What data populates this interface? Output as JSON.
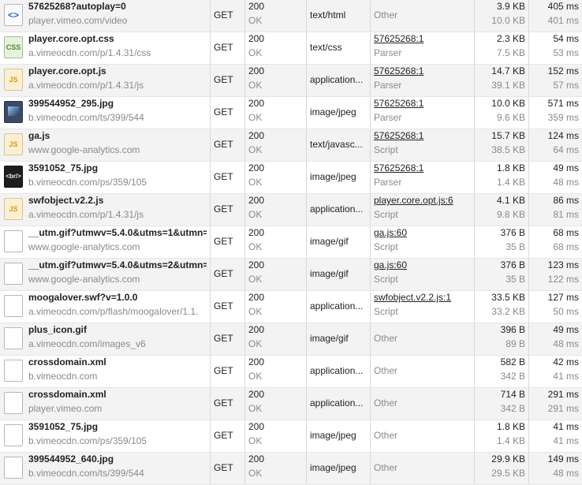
{
  "requests": [
    {
      "name": "57625268?autoplay=0",
      "domain": "player.vimeo.com/video",
      "icon": "html",
      "icon_label": "<>",
      "method": "GET",
      "status": "200",
      "status_text": "OK",
      "type": "text/html",
      "initiator": "Other",
      "initiator_detail": "",
      "size": "3.9 KB",
      "content": "10.0 KB",
      "time": "405 ms",
      "latency": "401 ms"
    },
    {
      "name": "player.core.opt.css",
      "domain": "a.vimeocdn.com/p/1.4.31/css",
      "icon": "css",
      "icon_label": "CSS",
      "method": "GET",
      "status": "200",
      "status_text": "OK",
      "type": "text/css",
      "initiator": "57625268:1",
      "initiator_detail": "Parser",
      "size": "2.3 KB",
      "content": "7.5 KB",
      "time": "54 ms",
      "latency": "53 ms"
    },
    {
      "name": "player.core.opt.js",
      "domain": "a.vimeocdn.com/p/1.4.31/js",
      "icon": "js",
      "icon_label": "JS",
      "method": "GET",
      "status": "200",
      "status_text": "OK",
      "type": "application...",
      "initiator": "57625268:1",
      "initiator_detail": "Parser",
      "size": "14.7 KB",
      "content": "39.1 KB",
      "time": "152 ms",
      "latency": "57 ms"
    },
    {
      "name": "399544952_295.jpg",
      "domain": "b.vimeocdn.com/ts/399/544",
      "icon": "image",
      "icon_label": "",
      "method": "GET",
      "status": "200",
      "status_text": "OK",
      "type": "image/jpeg",
      "initiator": "57625268:1",
      "initiator_detail": "Parser",
      "size": "10.0 KB",
      "content": "9.6 KB",
      "time": "571 ms",
      "latency": "359 ms"
    },
    {
      "name": "ga.js",
      "domain": "www.google-analytics.com",
      "icon": "js",
      "icon_label": "JS",
      "method": "GET",
      "status": "200",
      "status_text": "OK",
      "type": "text/javasc...",
      "initiator": "57625268:1",
      "initiator_detail": "Script",
      "size": "15.7 KB",
      "content": "38.5 KB",
      "time": "124 ms",
      "latency": "64 ms"
    },
    {
      "name": "3591052_75.jpg",
      "domain": "b.vimeocdn.com/ps/359/105",
      "icon": "dark",
      "icon_label": "<br/>",
      "method": "GET",
      "status": "200",
      "status_text": "OK",
      "type": "image/jpeg",
      "initiator": "57625268:1",
      "initiator_detail": "Parser",
      "size": "1.8 KB",
      "content": "1.4 KB",
      "time": "49 ms",
      "latency": "48 ms"
    },
    {
      "name": "swfobject.v2.2.js",
      "domain": "a.vimeocdn.com/p/1.4.31/js",
      "icon": "js",
      "icon_label": "JS",
      "method": "GET",
      "status": "200",
      "status_text": "OK",
      "type": "application...",
      "initiator": "player.core.opt.js:6",
      "initiator_detail": "Script",
      "size": "4.1 KB",
      "content": "9.8 KB",
      "time": "86 ms",
      "latency": "81 ms"
    },
    {
      "name": "__utm.gif?utmwv=5.4.0&utms=1&utmn=",
      "domain": "www.google-analytics.com",
      "icon": "blank",
      "icon_label": "",
      "method": "GET",
      "status": "200",
      "status_text": "OK",
      "type": "image/gif",
      "initiator": "ga.js:60",
      "initiator_detail": "Script",
      "size": "376 B",
      "content": "35 B",
      "time": "68 ms",
      "latency": "68 ms"
    },
    {
      "name": "__utm.gif?utmwv=5.4.0&utms=2&utmn=",
      "domain": "www.google-analytics.com",
      "icon": "blank",
      "icon_label": "",
      "method": "GET",
      "status": "200",
      "status_text": "OK",
      "type": "image/gif",
      "initiator": "ga.js:60",
      "initiator_detail": "Script",
      "size": "376 B",
      "content": "35 B",
      "time": "123 ms",
      "latency": "122 ms"
    },
    {
      "name": "moogalover.swf?v=1.0.0",
      "domain": "a.vimeocdn.com/p/flash/moogalover/1.1.",
      "icon": "blank",
      "icon_label": "",
      "method": "GET",
      "status": "200",
      "status_text": "OK",
      "type": "application...",
      "initiator": "swfobject.v2.2.js:1",
      "initiator_detail": "Script",
      "size": "33.5 KB",
      "content": "33.2 KB",
      "time": "127 ms",
      "latency": "50 ms"
    },
    {
      "name": "plus_icon.gif",
      "domain": "a.vimeocdn.com/images_v6",
      "icon": "blank",
      "icon_label": "",
      "method": "GET",
      "status": "200",
      "status_text": "OK",
      "type": "image/gif",
      "initiator": "Other",
      "initiator_detail": "",
      "size": "396 B",
      "content": "89 B",
      "time": "49 ms",
      "latency": "48 ms"
    },
    {
      "name": "crossdomain.xml",
      "domain": "b.vimeocdn.com",
      "icon": "blank",
      "icon_label": "",
      "method": "GET",
      "status": "200",
      "status_text": "OK",
      "type": "application...",
      "initiator": "Other",
      "initiator_detail": "",
      "size": "582 B",
      "content": "342 B",
      "time": "42 ms",
      "latency": "41 ms"
    },
    {
      "name": "crossdomain.xml",
      "domain": "player.vimeo.com",
      "icon": "blank",
      "icon_label": "",
      "method": "GET",
      "status": "200",
      "status_text": "OK",
      "type": "application...",
      "initiator": "Other",
      "initiator_detail": "",
      "size": "714 B",
      "content": "342 B",
      "time": "291 ms",
      "latency": "291 ms"
    },
    {
      "name": "3591052_75.jpg",
      "domain": "b.vimeocdn.com/ps/359/105",
      "icon": "blank",
      "icon_label": "",
      "method": "GET",
      "status": "200",
      "status_text": "OK",
      "type": "image/jpeg",
      "initiator": "Other",
      "initiator_detail": "",
      "size": "1.8 KB",
      "content": "1.4 KB",
      "time": "41 ms",
      "latency": "41 ms"
    },
    {
      "name": "399544952_640.jpg",
      "domain": "b.vimeocdn.com/ts/399/544",
      "icon": "blank",
      "icon_label": "",
      "method": "GET",
      "status": "200",
      "status_text": "OK",
      "type": "image/jpeg",
      "initiator": "Other",
      "initiator_detail": "",
      "size": "29.9 KB",
      "content": "29.5 KB",
      "time": "149 ms",
      "latency": "48 ms"
    }
  ]
}
